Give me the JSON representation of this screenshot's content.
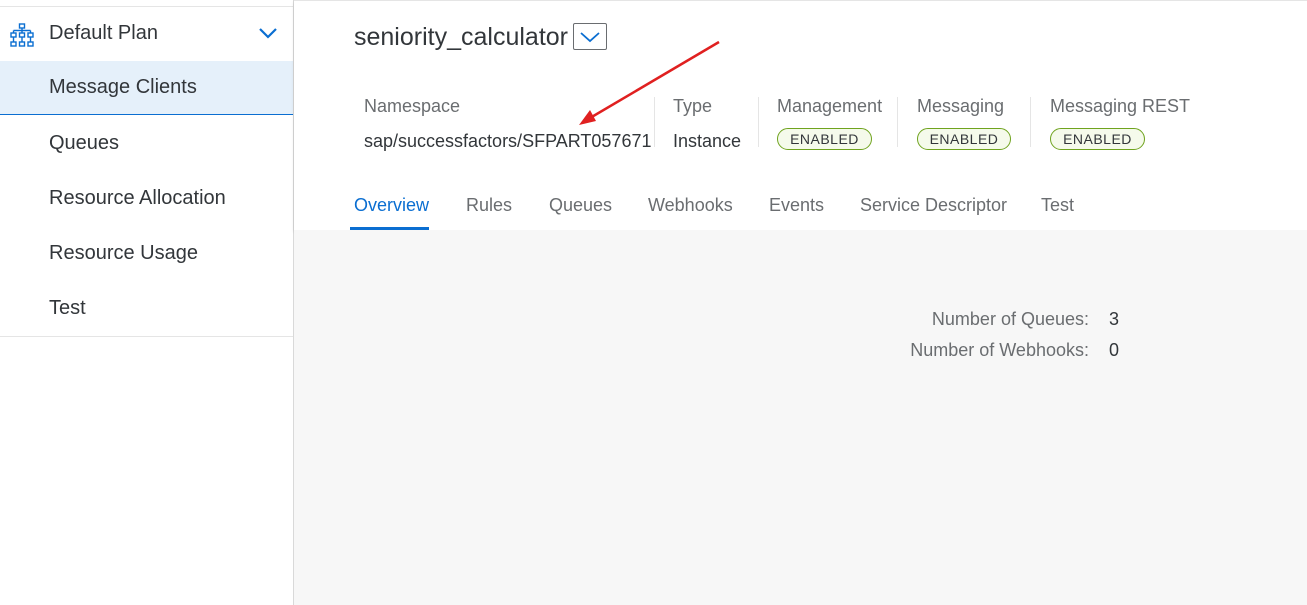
{
  "sidebar": {
    "plan_label": "Default Plan",
    "items": [
      {
        "label": "Message Clients",
        "active": true
      },
      {
        "label": "Queues"
      },
      {
        "label": "Resource Allocation"
      },
      {
        "label": "Resource Usage"
      },
      {
        "label": "Test"
      }
    ]
  },
  "header": {
    "title": "seniority_calculator",
    "columns": {
      "namespace": {
        "label": "Namespace",
        "value": "sap/successfactors/SFPART057671"
      },
      "type": {
        "label": "Type",
        "value": "Instance"
      },
      "management": {
        "label": "Management",
        "status": "ENABLED"
      },
      "messaging": {
        "label": "Messaging",
        "status": "ENABLED"
      },
      "messaging_rest": {
        "label": "Messaging REST",
        "status": "ENABLED"
      }
    }
  },
  "tabs": [
    "Overview",
    "Rules",
    "Queues",
    "Webhooks",
    "Events",
    "Service Descriptor",
    "Test"
  ],
  "overview": {
    "queues_label": "Number of Queues:",
    "queues_value": "3",
    "webhooks_label": "Number of Webhooks:",
    "webhooks_value": "0"
  },
  "colors": {
    "accent": "#0a6ed1",
    "enabled_border": "#6fa31e",
    "annotation_arrow": "#e02020"
  },
  "icons": {
    "plan": "network-icon",
    "expand": "chevron-down-icon"
  }
}
